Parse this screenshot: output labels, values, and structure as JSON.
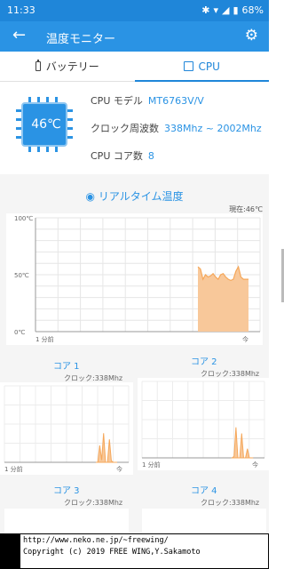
{
  "status": {
    "time": "11:33",
    "battery": "68%",
    "icons": [
      "bluetooth-icon",
      "wifi-icon",
      "signal-icon",
      "battery-icon"
    ]
  },
  "appbar": {
    "title": "温度モニター",
    "back_icon": "back-arrow-icon",
    "settings_icon": "gear-icon"
  },
  "tabs": [
    {
      "label": "バッテリー",
      "icon": "battery-icon",
      "active": false
    },
    {
      "label": "CPU",
      "icon": "cpu-icon",
      "active": true
    }
  ],
  "cpu": {
    "temperature": "46℃",
    "model_label": "CPU モデル",
    "model_value": "MT6763V/V",
    "clock_label": "クロック周波数",
    "clock_value": "338Mhz ~ 2002Mhz",
    "cores_label": "CPU コア数",
    "cores_value": "8"
  },
  "realtime": {
    "title": "リアルタイム温度",
    "icon": "thermometer-icon",
    "now": "現在:46℃"
  },
  "chart_data": [
    {
      "type": "area",
      "title": "リアルタイム温度",
      "ylabels": [
        "100℃",
        "50℃",
        "0℃"
      ],
      "xlabels": [
        "1 分前",
        "今"
      ],
      "ylim": [
        0,
        100
      ],
      "x": [
        0,
        1,
        2,
        3,
        4,
        5,
        6,
        7,
        8,
        9,
        10,
        11,
        12,
        13,
        14,
        15,
        16,
        17,
        18,
        19,
        20
      ],
      "values": [
        57,
        55,
        46,
        50,
        48,
        49,
        51,
        48,
        46,
        50,
        51,
        48,
        46,
        45,
        46,
        53,
        57,
        48,
        46,
        46,
        46
      ],
      "color": "#f5a75a"
    },
    {
      "type": "area",
      "title": "コア 1",
      "clock": "クロック:338Mhz",
      "xlabels": [
        "1 分前",
        "今"
      ],
      "values": [
        0,
        0,
        22,
        3,
        38,
        0,
        0,
        30,
        2,
        0,
        0,
        0
      ],
      "color": "#f5a75a"
    },
    {
      "type": "area",
      "title": "コア 2",
      "clock": "クロック:338Mhz",
      "xlabels": [
        "1 分前",
        "今"
      ],
      "values": [
        0,
        2,
        40,
        0,
        0,
        32,
        0,
        0,
        12,
        0,
        0,
        0
      ],
      "color": "#f5a75a"
    }
  ],
  "cores_more": [
    {
      "title": "コア 3",
      "clock": "クロック:338Mhz"
    },
    {
      "title": "コア 4",
      "clock": "クロック:338Mhz"
    }
  ],
  "footer": {
    "line1": "http://www.neko.ne.jp/~freewing/",
    "line2": "Copyright (c) 2019 FREE WING,Y.Sakamoto"
  }
}
